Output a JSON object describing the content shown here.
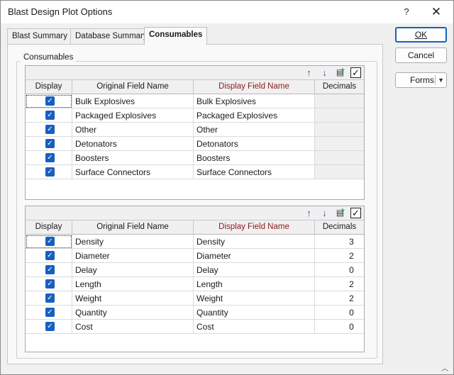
{
  "window": {
    "title": "Blast Design Plot Options",
    "help_label": "?",
    "close_label": "✕"
  },
  "tabs": [
    {
      "label": "Blast Summary",
      "active": false
    },
    {
      "label": "Database Summary",
      "active": false
    },
    {
      "label": "Consumables",
      "active": true
    }
  ],
  "group": {
    "label": "Consumables"
  },
  "columns": {
    "display": "Display",
    "original": "Original Field Name",
    "display_name": "Display Field Name",
    "decimals": "Decimals"
  },
  "grid1": {
    "rows": [
      {
        "checked": true,
        "original": "Bulk Explosives",
        "display": "Bulk Explosives",
        "decimals": ""
      },
      {
        "checked": true,
        "original": "Packaged Explosives",
        "display": "Packaged Explosives",
        "decimals": ""
      },
      {
        "checked": true,
        "original": "Other",
        "display": "Other",
        "decimals": ""
      },
      {
        "checked": true,
        "original": "Detonators",
        "display": "Detonators",
        "decimals": ""
      },
      {
        "checked": true,
        "original": "Boosters",
        "display": "Boosters",
        "decimals": ""
      },
      {
        "checked": true,
        "original": "Surface Connectors",
        "display": "Surface Connectors",
        "decimals": ""
      }
    ]
  },
  "grid2": {
    "rows": [
      {
        "checked": true,
        "original": "Density",
        "display": "Density",
        "decimals": "3"
      },
      {
        "checked": true,
        "original": "Diameter",
        "display": "Diameter",
        "decimals": "2"
      },
      {
        "checked": true,
        "original": "Delay",
        "display": "Delay",
        "decimals": "0"
      },
      {
        "checked": true,
        "original": "Length",
        "display": "Length",
        "decimals": "2"
      },
      {
        "checked": true,
        "original": "Weight",
        "display": "Weight",
        "decimals": "2"
      },
      {
        "checked": true,
        "original": "Quantity",
        "display": "Quantity",
        "decimals": "0"
      },
      {
        "checked": true,
        "original": "Cost",
        "display": "Cost",
        "decimals": "0"
      }
    ]
  },
  "toolbar_icons": [
    "move-up-icon",
    "move-down-icon",
    "add-column-icon",
    "select-all-checkbox-icon"
  ],
  "buttons": {
    "ok": "OK",
    "cancel": "Cancel",
    "forms": "Forms"
  },
  "colors": {
    "accent": "#1660c2",
    "display_header": "#8b1a1a"
  }
}
